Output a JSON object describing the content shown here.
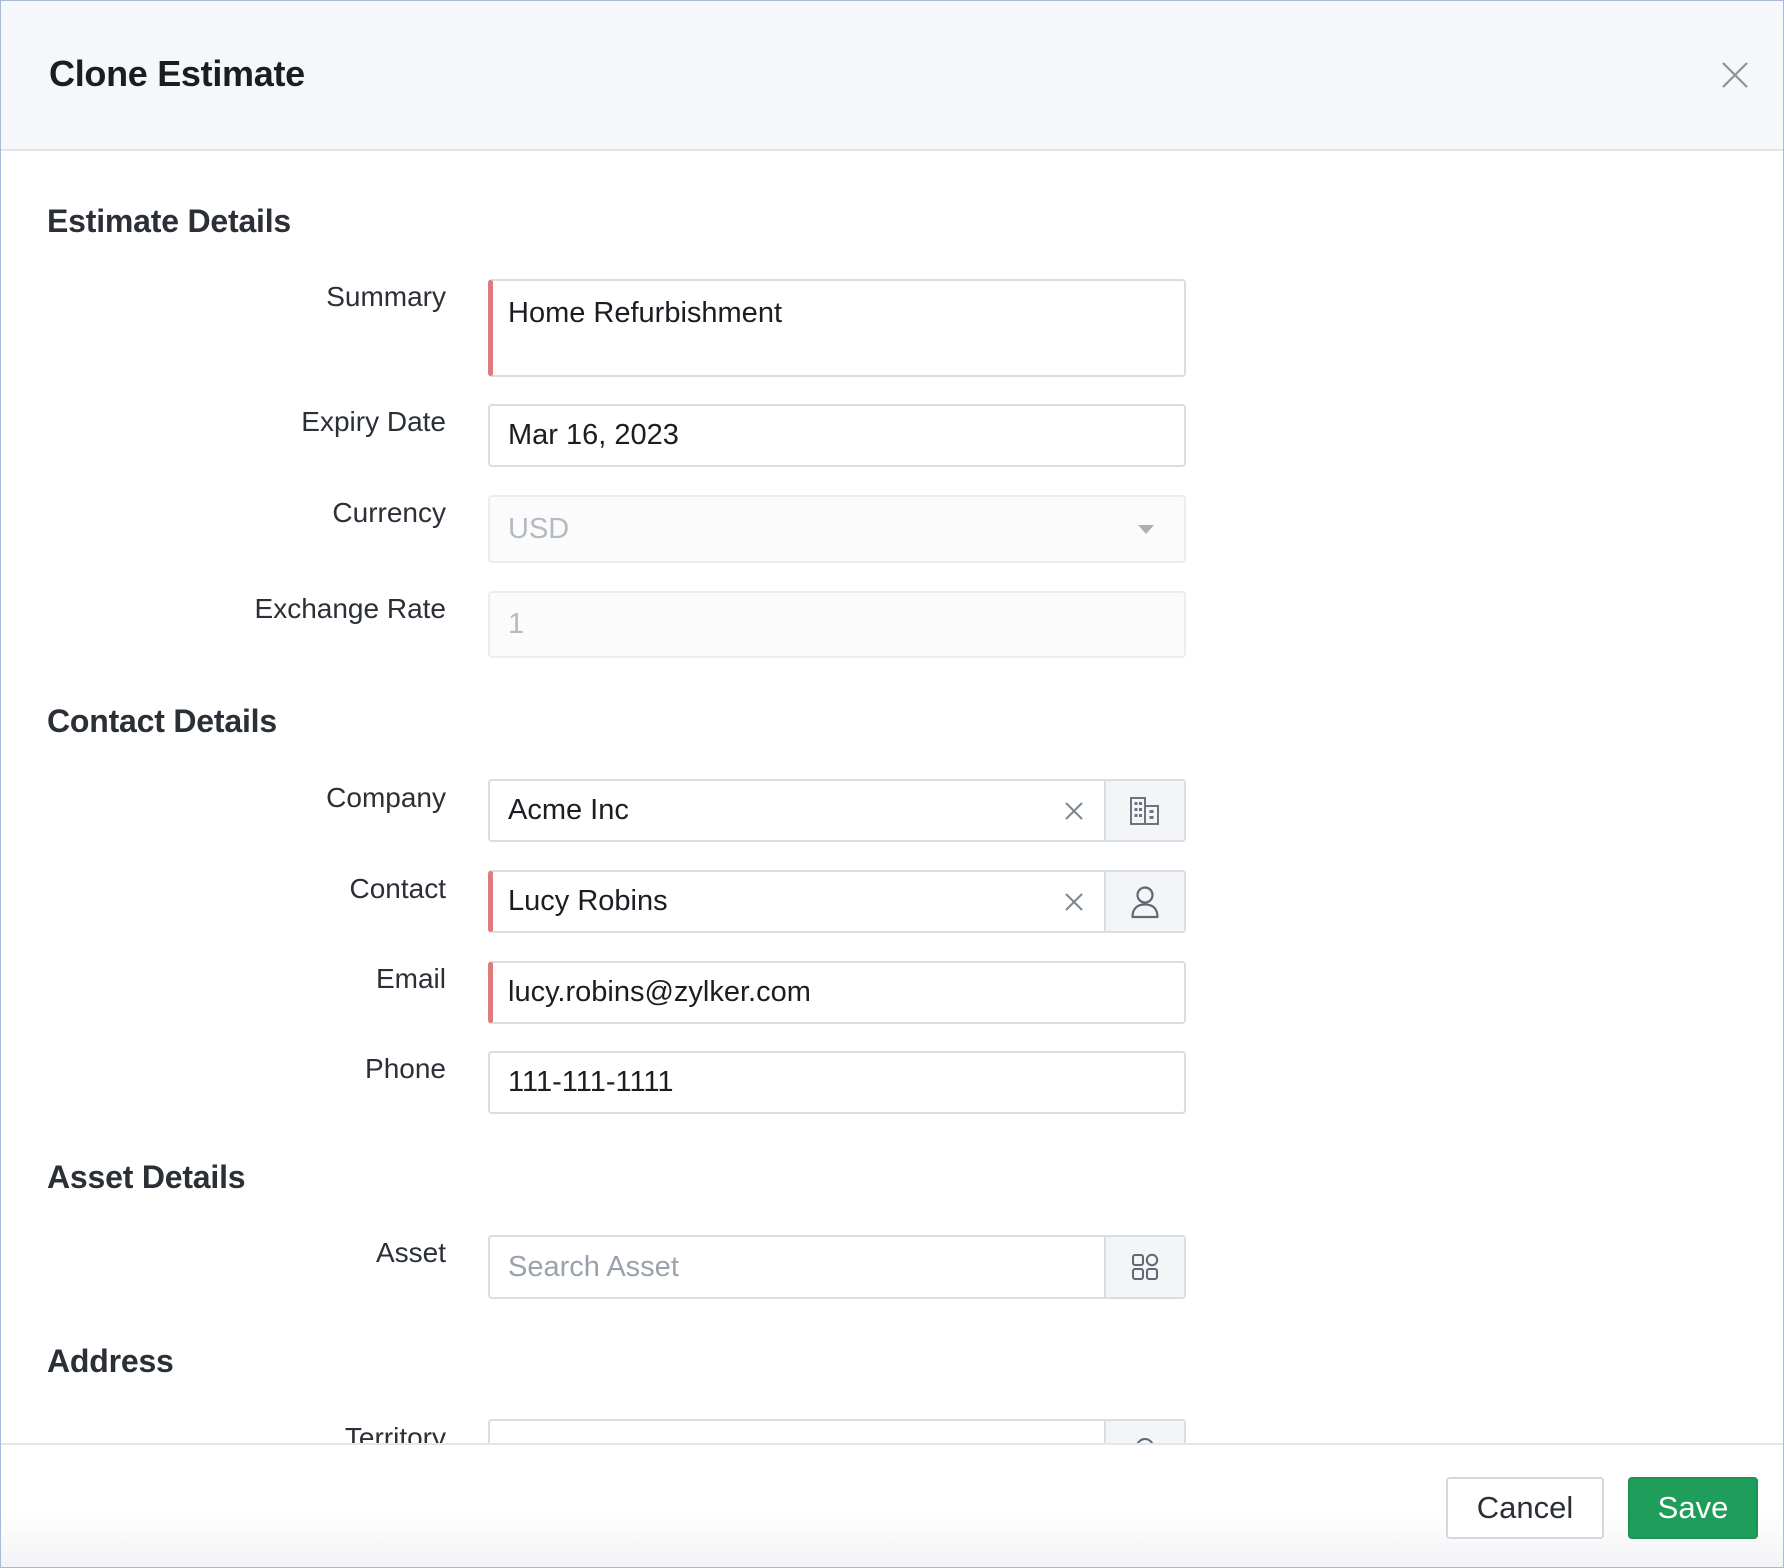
{
  "dialog": {
    "title": "Clone Estimate",
    "close_icon": "close-icon"
  },
  "estimate_details": {
    "heading": "Estimate Details",
    "summary": {
      "label": "Summary",
      "value": "Home Refurbishment",
      "required": true
    },
    "expiry_date": {
      "label": "Expiry Date",
      "value": "Mar 16, 2023"
    },
    "currency": {
      "label": "Currency",
      "value": "USD",
      "disabled": true
    },
    "exchange_rate": {
      "label": "Exchange Rate",
      "value": "1",
      "disabled": true
    }
  },
  "contact_details": {
    "heading": "Contact Details",
    "company": {
      "label": "Company",
      "value": "Acme Inc",
      "lookup_icon": "building-icon"
    },
    "contact": {
      "label": "Contact",
      "value": "Lucy Robins",
      "required": true,
      "lookup_icon": "person-icon"
    },
    "email": {
      "label": "Email",
      "value": "lucy.robins@zylker.com",
      "required": true
    },
    "phone": {
      "label": "Phone",
      "value": "111-111-1111"
    }
  },
  "asset_details": {
    "heading": "Asset Details",
    "asset": {
      "label": "Asset",
      "placeholder": "Search Asset",
      "lookup_icon": "grid-icon"
    }
  },
  "address": {
    "heading": "Address",
    "territory": {
      "label": "Territory",
      "lookup_icon": "map-pin-icon"
    }
  },
  "footer": {
    "cancel_label": "Cancel",
    "save_label": "Save"
  },
  "colors": {
    "required_marker": "#e07b7b",
    "save_button": "#1e9e5a",
    "header_bg": "#f5f7f9"
  }
}
